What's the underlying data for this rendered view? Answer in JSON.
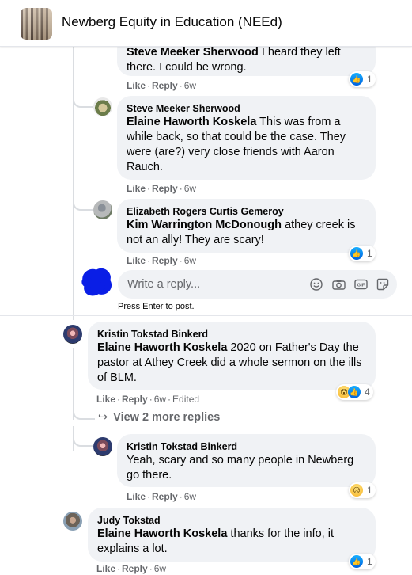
{
  "header": {
    "title": "Newberg Equity in Education (NEEd)"
  },
  "comments": [
    {
      "author": "Steve Meeker Sherwood",
      "mention": "",
      "text": "I heard they left there. I could be wrong.",
      "like": "Like",
      "reply": "Reply",
      "time": "6w",
      "edited": "",
      "reactions": {
        "icons": [
          "like-icon"
        ],
        "count": "1"
      }
    },
    {
      "author": "Steve Meeker Sherwood",
      "mention": "Elaine Haworth Koskela",
      "text": "This was from a while back, so that could be the case. They were (are?) very close friends with Aaron Rauch.",
      "like": "Like",
      "reply": "Reply",
      "time": "6w",
      "edited": "",
      "reactions": {
        "icons": [],
        "count": ""
      }
    },
    {
      "author": "Elizabeth Rogers Curtis Gemeroy",
      "mention": "Kim Warrington McDonough",
      "text": "athey creek is not an ally! They are scary!",
      "like": "Like",
      "reply": "Reply",
      "time": "6w",
      "edited": "",
      "reactions": {
        "icons": [
          "like-icon"
        ],
        "count": "1"
      }
    },
    {
      "author": "Kristin Tokstad Binkerd",
      "mention": "Elaine Haworth Koskela",
      "text": "2020 on Father's Day the pastor at Athey Creek did a whole sermon on the ills of BLM.",
      "like": "Like",
      "reply": "Reply",
      "time": "6w",
      "edited": "Edited",
      "reactions": {
        "icons": [
          "wow-icon",
          "like-icon"
        ],
        "count": "4"
      }
    },
    {
      "author": "Kristin Tokstad Binkerd",
      "mention": "",
      "text": "Yeah, scary and so many people in Newberg go there.",
      "like": "Like",
      "reply": "Reply",
      "time": "6w",
      "edited": "",
      "reactions": {
        "icons": [
          "sad-icon"
        ],
        "count": "1"
      }
    },
    {
      "author": "Judy Tokstad",
      "mention": "Elaine Haworth Koskela",
      "text": "thanks for the info, it explains a lot.",
      "like": "Like",
      "reply": "Reply",
      "time": "6w",
      "edited": "",
      "reactions": {
        "icons": [
          "like-icon"
        ],
        "count": "1"
      }
    }
  ],
  "reply_box": {
    "placeholder": "Write a reply...",
    "icons": [
      "emoji-icon",
      "camera-icon",
      "gif-icon",
      "sticker-icon"
    ],
    "hint": "Press Enter to post."
  },
  "more_replies": {
    "label": "View 2 more replies"
  },
  "colors": {
    "bubble": "#f0f2f5",
    "meta_text": "#65676b",
    "like_blue": "#0866ff",
    "scribble": "#0a1ee6"
  }
}
